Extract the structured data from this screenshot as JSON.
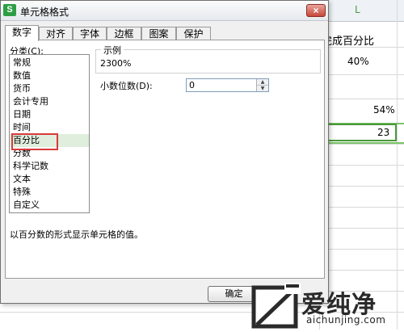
{
  "spreadsheet": {
    "column_header": "L",
    "header_cell": "完成百分比",
    "cells": [
      "40%",
      "54%",
      "23"
    ]
  },
  "dialog": {
    "title": "单元格格式",
    "close_label": "×",
    "tabs": [
      "数字",
      "对齐",
      "字体",
      "边框",
      "图案",
      "保护"
    ],
    "active_tab": "数字",
    "category_label": "分类(C):",
    "categories": [
      "常规",
      "数值",
      "货币",
      "会计专用",
      "日期",
      "时间",
      "百分比",
      "分数",
      "科学记数",
      "文本",
      "特殊",
      "自定义"
    ],
    "selected_category": "百分比",
    "example": {
      "title": "示例",
      "value": "2300%"
    },
    "decimal_places": {
      "label": "小数位数(D):",
      "value": "0"
    },
    "description": "以百分数的形式显示单元格的值。",
    "ok_label": "确定",
    "colors": {
      "selection_highlight": "#dfeedd",
      "red_annotation": "#d93a3a",
      "app_icon": "#2e9e45"
    }
  },
  "watermark": {
    "brand": "爱纯净",
    "url": "aichunjing.com"
  }
}
